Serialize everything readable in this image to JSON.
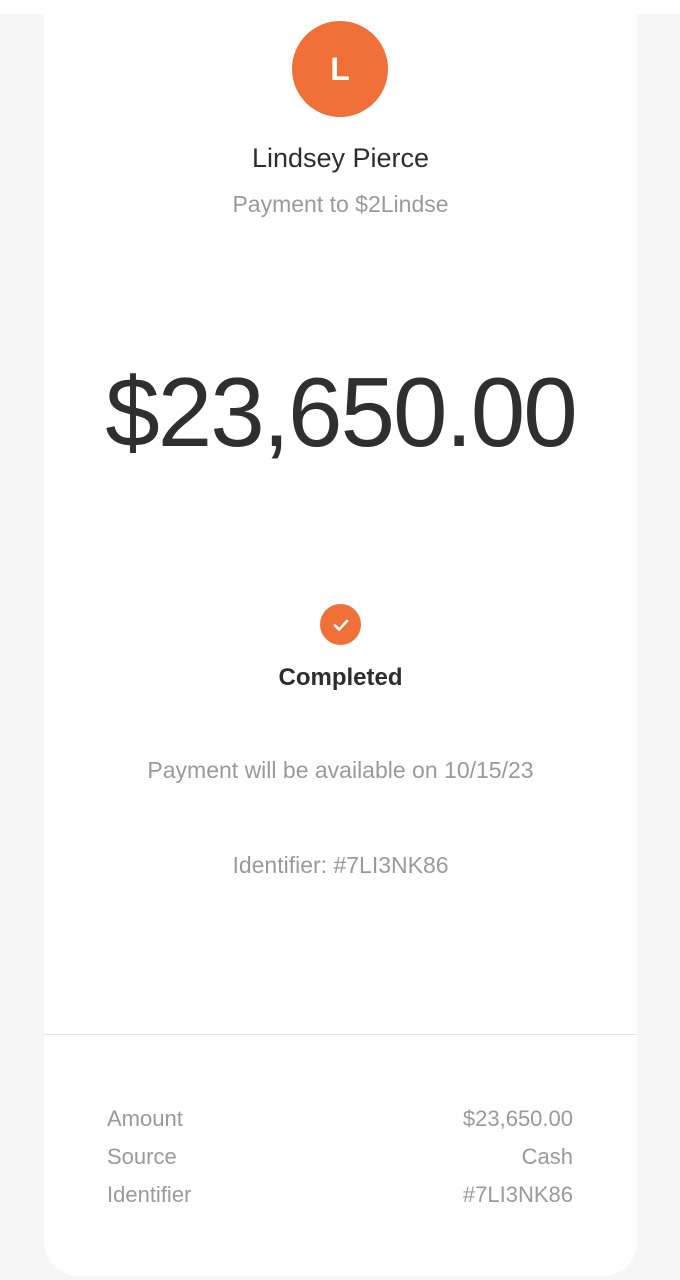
{
  "recipient": {
    "avatar_initial": "L",
    "name": "Lindsey Pierce",
    "subtitle": "Payment to $2Lindse"
  },
  "payment": {
    "amount": "$23,650.00",
    "status": "Completed",
    "availability": "Payment will be available on 10/15/23",
    "identifier_text": "Identifier: #7LI3NK86"
  },
  "details": [
    {
      "label": "Amount",
      "value": "$23,650.00"
    },
    {
      "label": "Source",
      "value": "Cash"
    },
    {
      "label": "Identifier",
      "value": "#7LI3NK86"
    }
  ],
  "colors": {
    "accent": "#f07038",
    "text_primary": "#2d2d2d",
    "text_secondary": "#9a9a9a",
    "background": "#f6f6f6",
    "card": "#ffffff"
  },
  "icons": {
    "status": "checkmark-circle-icon"
  }
}
